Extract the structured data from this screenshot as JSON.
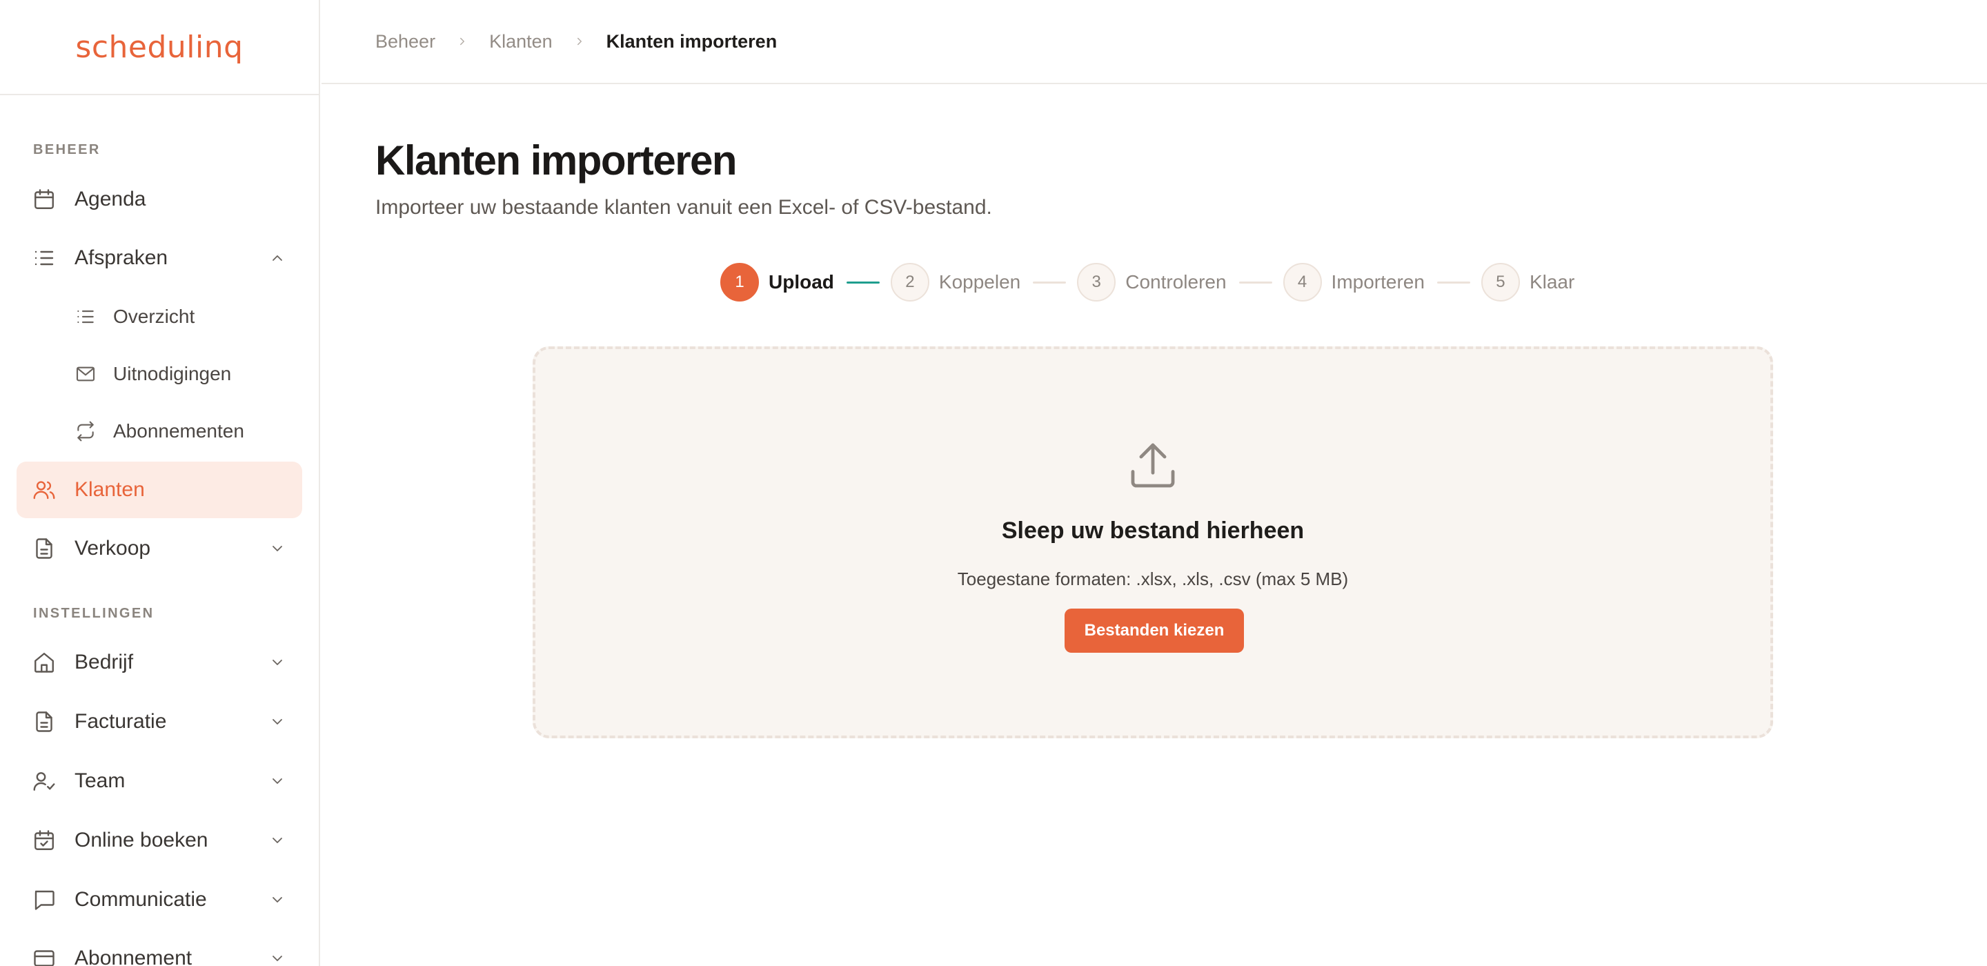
{
  "app": {
    "logo": "schedulinq"
  },
  "colors": {
    "accent": "#e8643a",
    "accent_soft": "#fdebe4",
    "progress": "#1f9e8e"
  },
  "sidebar": {
    "sections": [
      {
        "label": "BEHEER"
      },
      {
        "label": "INSTELLINGEN"
      }
    ],
    "items": [
      {
        "label": "Agenda",
        "icon": "calendar-icon"
      },
      {
        "label": "Afspraken",
        "icon": "list-icon",
        "expanded": true
      },
      {
        "label": "Overzicht",
        "icon": "list-icon"
      },
      {
        "label": "Uitnodigingen",
        "icon": "mail-icon"
      },
      {
        "label": "Abonnementen",
        "icon": "repeat-icon"
      },
      {
        "label": "Klanten",
        "icon": "users-icon",
        "active": true
      },
      {
        "label": "Verkoop",
        "icon": "document-icon"
      },
      {
        "label": "Bedrijf",
        "icon": "home-icon"
      },
      {
        "label": "Facturatie",
        "icon": "document-icon"
      },
      {
        "label": "Team",
        "icon": "user-check-icon"
      },
      {
        "label": "Online boeken",
        "icon": "calendar-check-icon"
      },
      {
        "label": "Communicatie",
        "icon": "chat-icon"
      },
      {
        "label": "Abonnement",
        "icon": "card-icon"
      }
    ]
  },
  "breadcrumb": [
    "Beheer",
    "Klanten",
    "Klanten importeren"
  ],
  "page": {
    "title": "Klanten importeren",
    "subtitle": "Importeer uw bestaande klanten vanuit een Excel- of CSV-bestand."
  },
  "stepper": {
    "current": 1,
    "steps": [
      {
        "number": "1",
        "label": "Upload"
      },
      {
        "number": "2",
        "label": "Koppelen"
      },
      {
        "number": "3",
        "label": "Controleren"
      },
      {
        "number": "4",
        "label": "Importeren"
      },
      {
        "number": "5",
        "label": "Klaar"
      }
    ]
  },
  "dropzone": {
    "icon": "upload-icon",
    "title": "Sleep uw bestand hierheen",
    "formats": "Toegestane formaten: .xlsx, .xls, .csv (max 5 MB)",
    "button": "Bestanden kiezen"
  }
}
